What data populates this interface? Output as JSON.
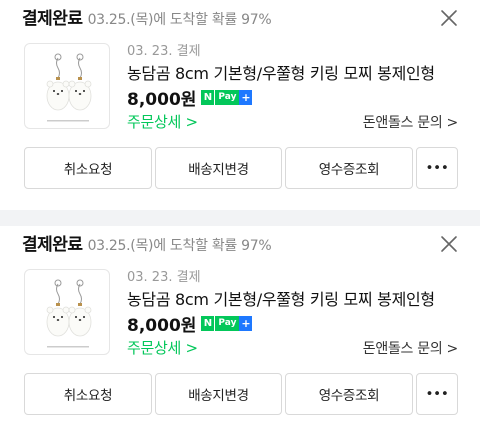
{
  "orders": [
    {
      "status": "결제완료",
      "arrival_note": "03.25.(목)에 도착할 확률 97%",
      "close_icon": "close-icon",
      "pay_date": "03. 23. 결제",
      "product_name": "농담곰 8cm 기본형/우쭐형 키링 모찌 봉제인형",
      "price": "8,000원",
      "npay": {
        "n": "N",
        "pay": "Pay",
        "plus": "+"
      },
      "detail_link": "주문상세 >",
      "seller_inquiry": "돈앤돌스 문의 >",
      "actions": [
        "취소요청",
        "배송지변경",
        "영수증조회",
        "•••"
      ]
    },
    {
      "status": "결제완료",
      "arrival_note": "03.25.(목)에 도착할 확률 97%",
      "close_icon": "close-icon",
      "pay_date": "03. 23. 결제",
      "product_name": "농담곰 8cm 기본형/우쭐형 키링 모찌 봉제인형",
      "price": "8,000원",
      "npay": {
        "n": "N",
        "pay": "Pay",
        "plus": "+"
      },
      "detail_link": "주문상세 >",
      "seller_inquiry": "돈앤돌스 문의 >",
      "actions": [
        "취소요청",
        "배송지변경",
        "영수증조회",
        "•••"
      ]
    }
  ],
  "colors": {
    "accent_green": "#03c75a",
    "npay_blue": "#1e78ff",
    "muted_text": "#888888",
    "divider_bg": "#f2f3f5"
  }
}
